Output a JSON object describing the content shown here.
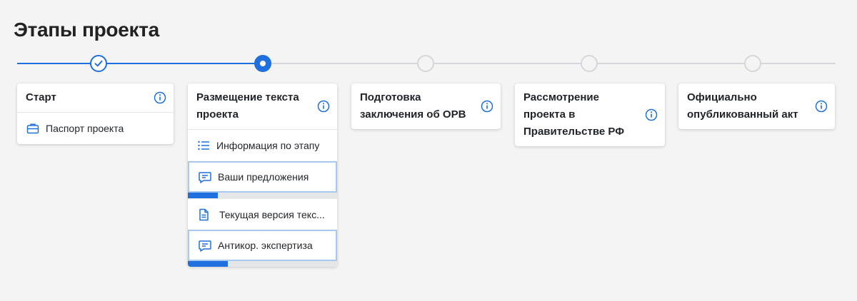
{
  "page": {
    "title": "Этапы проекта"
  },
  "colors": {
    "accent": "#1f6fde",
    "inactive": "#d5d7da",
    "background": "#f4f4f5"
  },
  "timeline": {
    "steps": [
      {
        "state": "done",
        "icon": "check-icon"
      },
      {
        "state": "current",
        "icon": "dot-icon"
      },
      {
        "state": "todo"
      },
      {
        "state": "todo"
      },
      {
        "state": "todo"
      }
    ]
  },
  "stages": [
    {
      "title": "Старт",
      "items": [
        {
          "label": "Паспорт проекта",
          "icon": "briefcase-icon"
        }
      ]
    },
    {
      "title": "Размещение текста проекта",
      "items": [
        {
          "label": "Информация по этапу",
          "icon": "list-icon"
        },
        {
          "label": "Ваши предложения",
          "icon": "comment-icon",
          "progress_percent": 20
        },
        {
          "label": "Текущая версия текс...",
          "icon": "document-icon"
        },
        {
          "label": "Антикор. экспертиза",
          "icon": "comment-icon",
          "progress_percent": 27
        }
      ]
    },
    {
      "title": "Подготовка заключения об ОРВ",
      "items": []
    },
    {
      "title": "Рассмотрение проекта в Правительстве РФ",
      "items": []
    },
    {
      "title": "Официально опубликованный акт",
      "items": []
    }
  ]
}
